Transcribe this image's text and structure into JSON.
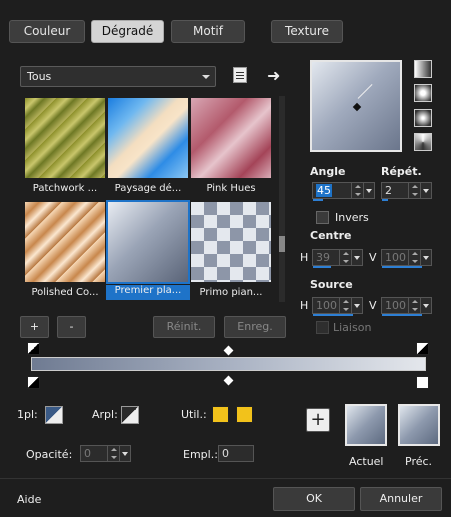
{
  "tabs": [
    "Couleur",
    "Dégradé",
    "Motif",
    "Texture"
  ],
  "dropdown": {
    "value": "Tous"
  },
  "thumbnails": [
    {
      "label": "Patchwork ..."
    },
    {
      "label": "Paysage dé..."
    },
    {
      "label": "Pink Hues"
    },
    {
      "label": "Polished Co..."
    },
    {
      "label": "Premier pla..."
    },
    {
      "label": "Primo pian..."
    }
  ],
  "controls": {
    "angle_label": "Angle",
    "angle_value": "45",
    "repeat_label": "Répét.",
    "repeat_value": "2",
    "invert_label": "Invers",
    "centre_label": "Centre",
    "centre_h_label": "H",
    "centre_h_value": "39",
    "centre_v_label": "V",
    "centre_v_value": "100",
    "source_label": "Source",
    "source_h_label": "H",
    "source_h_value": "100",
    "source_v_label": "V",
    "source_v_value": "100",
    "link_label": "Liaison"
  },
  "list_buttons": {
    "add": "+",
    "remove": "-",
    "reset": "Réinit.",
    "save": "Enreg."
  },
  "stops": {
    "opl_label": "1pl:",
    "arpl_label": "Arpl:",
    "util_label": "Util.:",
    "opacity_label": "Opacité:",
    "opacity_value": "0",
    "empl_label": "Empl.:",
    "empl_value": "0"
  },
  "previews": {
    "add": "+",
    "current_label": "Actuel",
    "previous_label": "Préc."
  },
  "footer": {
    "help": "Aide",
    "ok": "OK",
    "cancel": "Annuler"
  },
  "colors": {
    "accent": "#1e73c8",
    "swatch": "#f2c21b"
  }
}
